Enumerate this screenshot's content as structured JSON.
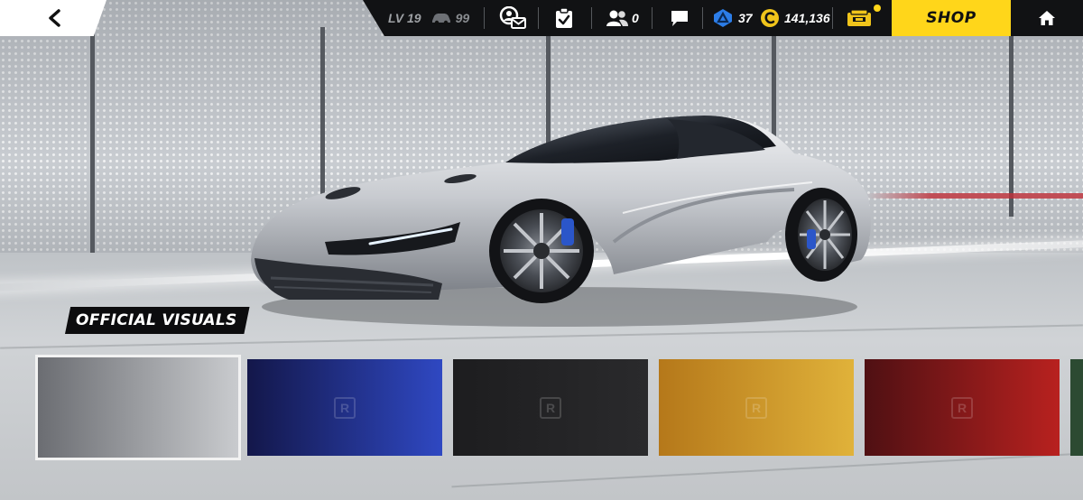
{
  "topbar": {
    "level": "LV 19",
    "cars_owned": "99",
    "friends_count": "0",
    "tokens": "37",
    "credits": "141,136",
    "shop_label": "SHOP"
  },
  "badge": {
    "official_visuals": "OFFICIAL VISUALS"
  },
  "swatches": [
    {
      "name": "silver",
      "colors": [
        "#6b6d72",
        "#c9cbce"
      ],
      "selected": true,
      "lock_label": ""
    },
    {
      "name": "blue",
      "colors": [
        "#13174a",
        "#2f48c2"
      ],
      "selected": false,
      "lock_label": "R"
    },
    {
      "name": "black",
      "colors": [
        "#1d1d1f",
        "#2a2a2c"
      ],
      "selected": false,
      "lock_label": "R"
    },
    {
      "name": "gold",
      "colors": [
        "#b5781a",
        "#e0b23a"
      ],
      "selected": false,
      "lock_label": "R"
    },
    {
      "name": "red",
      "colors": [
        "#4f1013",
        "#b8211f"
      ],
      "selected": false,
      "lock_label": "R"
    }
  ],
  "colors": {
    "shop_yellow": "#ffd61a",
    "topbar_bg": "#111214",
    "token_blue": "#2c7de8",
    "credit_gold": "#f0c41b"
  },
  "icons": {
    "back": "chevron-left-icon",
    "car": "car-icon",
    "profile": "profile-mail-icon",
    "tasks": "clipboard-check-icon",
    "friends": "friends-icon",
    "chat": "chat-bubble-icon",
    "token": "token-icon",
    "credit": "credit-coin-icon",
    "pack": "card-pack-icon",
    "home": "home-icon"
  }
}
